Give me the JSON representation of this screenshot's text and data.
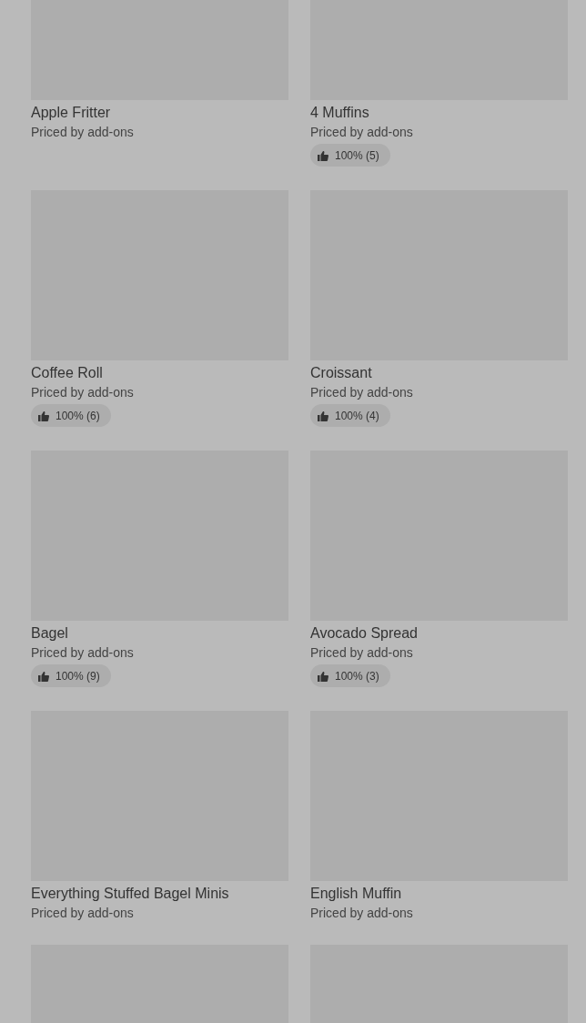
{
  "items": [
    {
      "kind": "product",
      "name": "Apple Fritter",
      "note": "Priced by add-ons"
    },
    {
      "kind": "product",
      "name": "4 Muffins",
      "note": "Priced by add-ons",
      "rating": "100% (5)"
    },
    {
      "kind": "product",
      "name": "Coffee Roll",
      "note": "Priced by add-ons",
      "rating": "100% (6)"
    },
    {
      "kind": "product",
      "name": "Croissant",
      "note": "Priced by add-ons",
      "rating": "100% (4)"
    },
    {
      "kind": "product",
      "name": "Bagel",
      "note": "Priced by add-ons",
      "rating": "100% (9)"
    },
    {
      "kind": "product",
      "name": "Avocado Spread",
      "note": "Priced by add-ons",
      "rating": "100% (3)"
    },
    {
      "kind": "product",
      "name": "Everything Stuffed Bagel Minis",
      "note": "Priced by add-ons"
    },
    {
      "kind": "product",
      "name": "English Muffin",
      "note": "Priced by add-ons"
    },
    {
      "kind": "picture"
    },
    {
      "kind": "picture"
    }
  ]
}
